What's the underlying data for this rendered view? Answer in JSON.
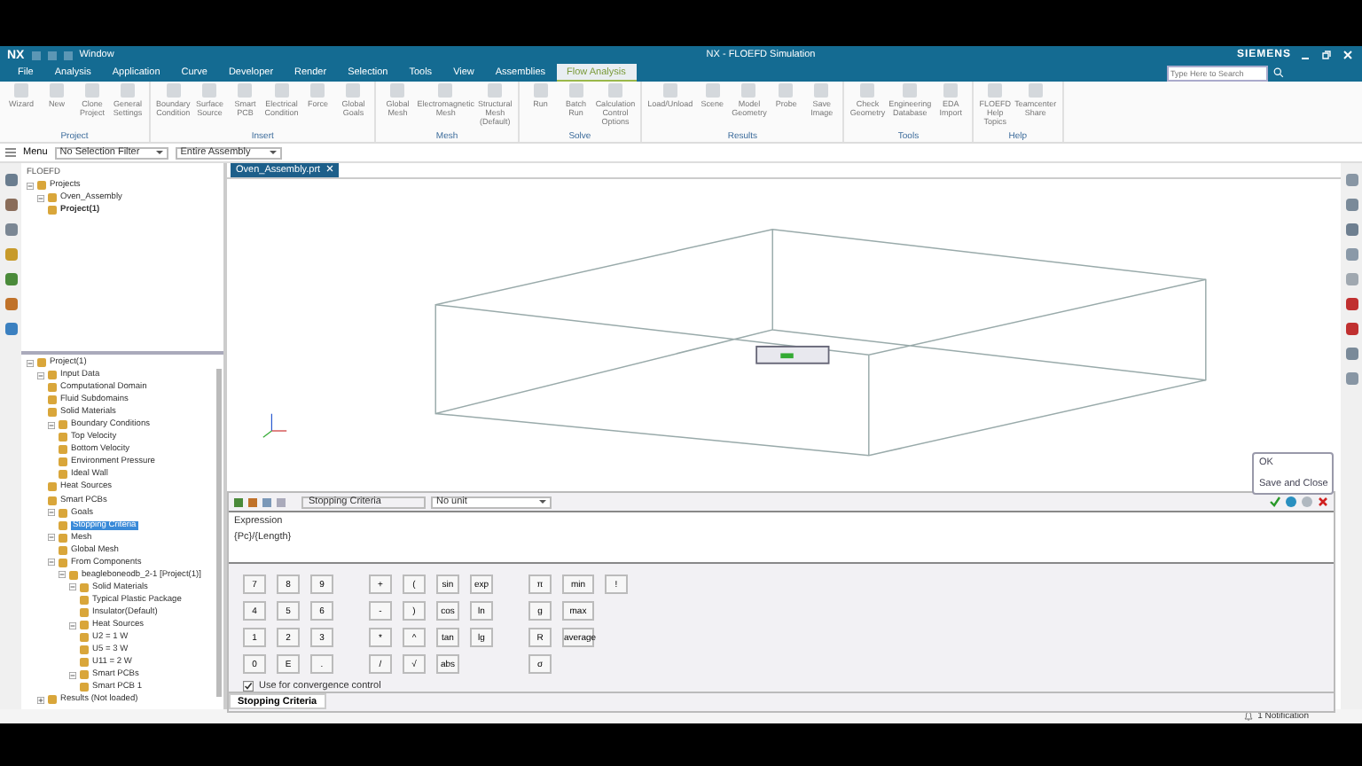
{
  "title_bar": {
    "app": "NX",
    "window_menu": "Window",
    "title": "NX - FLOEFD Simulation",
    "brand": "SIEMENS"
  },
  "menu": [
    {
      "label": "File",
      "selected": false
    },
    {
      "label": "Analysis",
      "selected": false
    },
    {
      "label": "Application",
      "selected": false
    },
    {
      "label": "Curve",
      "selected": false
    },
    {
      "label": "Developer",
      "selected": false
    },
    {
      "label": "Render",
      "selected": false
    },
    {
      "label": "Selection",
      "selected": false
    },
    {
      "label": "Tools",
      "selected": false
    },
    {
      "label": "View",
      "selected": false
    },
    {
      "label": "Assemblies",
      "selected": false
    },
    {
      "label": "Flow Analysis",
      "selected": true
    }
  ],
  "search": {
    "placeholder": "Type Here to Search"
  },
  "ribbon": [
    {
      "label": "Project",
      "commands": [
        "Wizard",
        "New",
        "Clone Project",
        "General Settings"
      ]
    },
    {
      "label": "Insert",
      "commands": [
        "Boundary Condition",
        "Surface Source",
        "Smart PCB",
        "Electrical Condition",
        "Force",
        "Global Goals"
      ]
    },
    {
      "label": "Mesh",
      "commands": [
        "Global Mesh",
        "Electromagnetic Mesh",
        "Structural Mesh (Default)"
      ]
    },
    {
      "label": "Solve",
      "commands": [
        "Run",
        "Batch Run",
        "Calculation Control Options"
      ]
    },
    {
      "label": "Results",
      "commands": [
        "Load/Unload",
        "Scene",
        "Model Geometry",
        "Probe",
        "Save Image"
      ]
    },
    {
      "label": "Tools",
      "commands": [
        "Check Geometry",
        "Engineering Database",
        "EDA Import"
      ]
    },
    {
      "label": "Help",
      "commands": [
        "FLOEFD Help Topics",
        "Teamcenter Share"
      ]
    }
  ],
  "filter_bar": {
    "menu": "Menu",
    "selection_filter": "No Selection Filter",
    "scope": "Entire Assembly"
  },
  "project_panel": {
    "title": "FLOEFD",
    "tree": [
      {
        "label": "Projects",
        "active": false,
        "expanded": true,
        "children": [
          {
            "label": "Oven_Assembly",
            "active": false,
            "expanded": true,
            "children": [
              {
                "label": "Project(1)",
                "active": true
              }
            ]
          }
        ]
      }
    ]
  },
  "document_tab": "Oven_Assembly.prt",
  "analysis_tree": [
    {
      "label": "Project(1)",
      "selected": false,
      "expanded": true,
      "children": [
        {
          "label": "Input Data",
          "selected": false,
          "expanded": true,
          "children": [
            {
              "label": "Computational Domain",
              "selected": false
            },
            {
              "label": "Fluid Subdomains",
              "selected": false
            },
            {
              "label": "Solid Materials",
              "selected": false
            },
            {
              "label": "Boundary Conditions",
              "selected": false,
              "expanded": true,
              "children": [
                {
                  "label": "Top Velocity",
                  "selected": false
                },
                {
                  "label": "Bottom Velocity",
                  "selected": false
                },
                {
                  "label": "Environment Pressure",
                  "selected": false
                },
                {
                  "label": "Ideal Wall",
                  "selected": false
                }
              ]
            },
            {
              "label": "Heat Sources",
              "selected": false
            },
            {
              "label": "Smart PCBs",
              "selected": false
            },
            {
              "label": "Goals",
              "selected": false,
              "expanded": true,
              "children": [
                {
                  "label": "Stopping Criteria",
                  "selected": true
                }
              ]
            },
            {
              "label": "Mesh",
              "selected": false,
              "expanded": true,
              "children": [
                {
                  "label": "Global Mesh",
                  "selected": false
                }
              ]
            },
            {
              "label": "From Components",
              "selected": false,
              "expanded": true,
              "children": [
                {
                  "label": "beagleboneodb_2-1 [Project(1)]",
                  "selected": false,
                  "expanded": true,
                  "children": [
                    {
                      "label": "Solid Materials",
                      "selected": false,
                      "expanded": true,
                      "children": [
                        {
                          "label": "Typical Plastic Package",
                          "selected": false
                        },
                        {
                          "label": "Insulator(Default)",
                          "selected": false
                        }
                      ]
                    },
                    {
                      "label": "Heat Sources",
                      "selected": false,
                      "expanded": true,
                      "children": [
                        {
                          "label": "U2 = 1 W",
                          "selected": false
                        },
                        {
                          "label": "U5 = 3 W",
                          "selected": false
                        },
                        {
                          "label": "U11 = 2 W",
                          "selected": false
                        }
                      ]
                    },
                    {
                      "label": "Smart PCBs",
                      "selected": false,
                      "expanded": true,
                      "children": [
                        {
                          "label": "Smart PCB 1",
                          "selected": false
                        }
                      ]
                    }
                  ]
                }
              ]
            }
          ]
        },
        {
          "label": "Results (Not loaded)",
          "selected": false,
          "expanded": false
        }
      ]
    }
  ],
  "editor": {
    "name": "Stopping Criteria",
    "unit": "No unit",
    "expression_label": "Expression",
    "expression": "{Pc}/{Length}",
    "keypad": [
      [
        [
          "7",
          "8",
          "9"
        ],
        [
          "4",
          "5",
          "6"
        ],
        [
          "1",
          "2",
          "3"
        ],
        [
          "0",
          "E",
          "."
        ]
      ],
      [
        [
          "+",
          "(",
          "sin",
          "exp"
        ],
        [
          "-",
          ")",
          "cos",
          "ln"
        ],
        [
          "*",
          "^",
          "tan",
          "lg"
        ],
        [
          "/",
          "√",
          "abs"
        ]
      ],
      [
        [
          "π",
          "min",
          "!"
        ],
        [
          "g",
          "max"
        ],
        [
          "R",
          "average"
        ],
        [
          "σ"
        ]
      ]
    ],
    "convergence": {
      "label": "Use for convergence control",
      "checked": true
    },
    "tab": {
      "label": "Stopping Criteria",
      "selected": true
    }
  },
  "ok_menu": [
    "OK",
    "Save and Close"
  ],
  "status_bar": {
    "notifications": "1 Notification"
  }
}
